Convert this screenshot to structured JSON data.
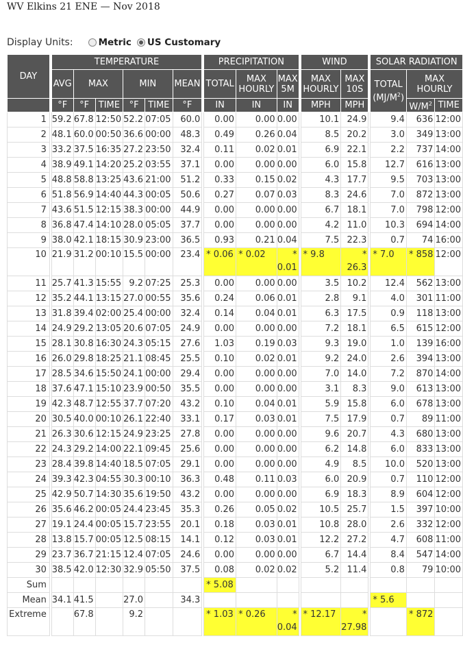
{
  "title": "WV Elkins 21 ENE — Nov 2018",
  "display_units": {
    "label": "Display Units:",
    "options": [
      {
        "label": "Metric",
        "selected": false
      },
      {
        "label": "US Customary",
        "selected": true
      }
    ]
  },
  "headers": {
    "day": "DAY",
    "temperature": "TEMPERATURE",
    "precipitation": "PRECIPITATION",
    "wind": "WIND",
    "solar": "SOLAR RADIATION",
    "avg": "AVG",
    "max": "MAX",
    "min": "MIN",
    "mean": "MEAN",
    "total": "TOTAL",
    "max_hourly": [
      "MAX",
      "HOURLY"
    ],
    "max_5m": [
      "MAX",
      "5M"
    ],
    "wind_max_hourly": [
      "MAX",
      "HOURLY"
    ],
    "max_10s": [
      "MAX",
      "10S"
    ],
    "solar_total": "TOTAL",
    "solar_unit": [
      "(MJ/M",
      "2",
      ")"
    ],
    "solar_max_hourly": [
      "MAX",
      "HOURLY"
    ],
    "units": [
      "°F",
      "°F",
      "TIME",
      "°F",
      "TIME",
      "°F",
      "IN",
      "IN",
      "IN",
      "MPH",
      "MPH",
      "W/M",
      "TIME"
    ]
  },
  "rows": [
    [
      "1",
      "59.2",
      "67.8",
      "12:50",
      "52.2",
      "07:05",
      "60.0",
      "0.00",
      "0.00",
      "0.00",
      "10.1",
      "24.9",
      "9.4",
      "636",
      "12:00"
    ],
    [
      "2",
      "48.1",
      "60.0",
      "00:50",
      "36.6",
      "00:00",
      "48.3",
      "0.49",
      "0.26",
      "0.04",
      "8.5",
      "20.2",
      "3.0",
      "349",
      "13:00"
    ],
    [
      "3",
      "33.2",
      "37.5",
      "16:35",
      "27.2",
      "23:50",
      "32.4",
      "0.11",
      "0.02",
      "0.01",
      "6.9",
      "22.1",
      "2.2",
      "737",
      "14:00"
    ],
    [
      "4",
      "38.9",
      "49.1",
      "14:20",
      "25.2",
      "03:55",
      "37.1",
      "0.00",
      "0.00",
      "0.00",
      "6.0",
      "15.8",
      "12.7",
      "616",
      "13:00"
    ],
    [
      "5",
      "48.8",
      "58.8",
      "13:25",
      "43.6",
      "21:00",
      "51.2",
      "0.33",
      "0.15",
      "0.02",
      "4.3",
      "17.7",
      "9.5",
      "703",
      "13:00"
    ],
    [
      "6",
      "51.8",
      "56.9",
      "14:40",
      "44.3",
      "00:05",
      "50.6",
      "0.27",
      "0.07",
      "0.03",
      "8.3",
      "24.6",
      "7.0",
      "872",
      "13:00"
    ],
    [
      "7",
      "43.6",
      "51.5",
      "12:15",
      "38.3",
      "00:00",
      "44.9",
      "0.00",
      "0.00",
      "0.00",
      "6.7",
      "18.1",
      "7.0",
      "798",
      "12:00"
    ],
    [
      "8",
      "36.8",
      "47.4",
      "14:10",
      "28.0",
      "05:05",
      "37.7",
      "0.00",
      "0.00",
      "0.00",
      "4.2",
      "11.0",
      "10.3",
      "694",
      "14:00"
    ],
    [
      "9",
      "38.0",
      "42.1",
      "18:15",
      "30.9",
      "23:00",
      "36.5",
      "0.93",
      "0.21",
      "0.04",
      "7.5",
      "22.3",
      "0.7",
      "74",
      "16:00"
    ],
    [
      "10",
      "21.9",
      "31.2",
      "00:10",
      "15.5",
      "00:00",
      "23.4",
      "* 0.06",
      "* 0.02",
      "0.01",
      "* 9.8",
      "26.3",
      "* 7.0",
      "* 858",
      "12:00"
    ],
    [
      "11",
      "25.7",
      "41.3",
      "15:55",
      "9.2",
      "07:25",
      "25.3",
      "0.00",
      "0.00",
      "0.00",
      "3.5",
      "10.2",
      "12.4",
      "562",
      "13:00"
    ],
    [
      "12",
      "35.2",
      "44.1",
      "13:15",
      "27.0",
      "00:55",
      "35.6",
      "0.24",
      "0.06",
      "0.01",
      "2.8",
      "9.1",
      "4.0",
      "301",
      "11:00"
    ],
    [
      "13",
      "31.8",
      "39.4",
      "02:00",
      "25.4",
      "00:00",
      "32.4",
      "0.14",
      "0.04",
      "0.01",
      "6.3",
      "17.5",
      "0.9",
      "118",
      "13:00"
    ],
    [
      "14",
      "24.9",
      "29.2",
      "13:05",
      "20.6",
      "07:05",
      "24.9",
      "0.00",
      "0.00",
      "0.00",
      "7.2",
      "18.1",
      "6.5",
      "615",
      "12:00"
    ],
    [
      "15",
      "28.1",
      "30.8",
      "16:30",
      "24.3",
      "05:15",
      "27.6",
      "1.03",
      "0.19",
      "0.03",
      "9.3",
      "19.0",
      "1.0",
      "139",
      "16:00"
    ],
    [
      "16",
      "26.0",
      "29.8",
      "18:25",
      "21.1",
      "08:45",
      "25.5",
      "0.10",
      "0.02",
      "0.01",
      "9.2",
      "24.0",
      "2.6",
      "394",
      "13:00"
    ],
    [
      "17",
      "28.5",
      "34.6",
      "15:50",
      "24.1",
      "00:00",
      "29.4",
      "0.00",
      "0.00",
      "0.00",
      "7.0",
      "14.0",
      "7.2",
      "870",
      "14:00"
    ],
    [
      "18",
      "37.6",
      "47.1",
      "15:10",
      "23.9",
      "00:50",
      "35.5",
      "0.00",
      "0.00",
      "0.00",
      "3.1",
      "8.3",
      "9.0",
      "613",
      "13:00"
    ],
    [
      "19",
      "42.3",
      "48.7",
      "12:55",
      "37.7",
      "07:20",
      "43.2",
      "0.10",
      "0.04",
      "0.01",
      "5.9",
      "15.8",
      "6.0",
      "678",
      "13:00"
    ],
    [
      "20",
      "30.5",
      "40.0",
      "00:10",
      "26.1",
      "22:40",
      "33.1",
      "0.17",
      "0.03",
      "0.01",
      "7.5",
      "17.9",
      "0.7",
      "89",
      "11:00"
    ],
    [
      "21",
      "26.3",
      "30.6",
      "12:15",
      "24.9",
      "23:25",
      "27.8",
      "0.00",
      "0.00",
      "0.00",
      "9.6",
      "20.7",
      "4.3",
      "680",
      "13:00"
    ],
    [
      "22",
      "24.3",
      "29.2",
      "14:00",
      "22.1",
      "09:45",
      "25.6",
      "0.00",
      "0.00",
      "0.00",
      "6.2",
      "14.8",
      "6.0",
      "833",
      "13:00"
    ],
    [
      "23",
      "28.4",
      "39.8",
      "14:40",
      "18.5",
      "07:05",
      "29.1",
      "0.00",
      "0.00",
      "0.00",
      "4.9",
      "8.5",
      "10.0",
      "520",
      "13:00"
    ],
    [
      "24",
      "39.3",
      "42.3",
      "04:55",
      "30.3",
      "00:10",
      "36.3",
      "0.48",
      "0.11",
      "0.03",
      "6.0",
      "20.9",
      "0.7",
      "110",
      "12:00"
    ],
    [
      "25",
      "42.9",
      "50.7",
      "14:30",
      "35.6",
      "19:50",
      "43.2",
      "0.00",
      "0.00",
      "0.00",
      "6.9",
      "18.3",
      "8.9",
      "604",
      "12:00"
    ],
    [
      "26",
      "35.6",
      "46.2",
      "00:05",
      "24.4",
      "23:45",
      "35.3",
      "0.26",
      "0.05",
      "0.02",
      "10.5",
      "25.7",
      "1.5",
      "397",
      "10:00"
    ],
    [
      "27",
      "19.1",
      "24.4",
      "00:05",
      "15.7",
      "23:55",
      "20.1",
      "0.18",
      "0.03",
      "0.01",
      "10.8",
      "28.0",
      "2.6",
      "332",
      "12:00"
    ],
    [
      "28",
      "13.8",
      "15.7",
      "00:05",
      "12.5",
      "08:15",
      "14.1",
      "0.12",
      "0.03",
      "0.01",
      "12.2",
      "27.2",
      "4.7",
      "608",
      "11:00"
    ],
    [
      "29",
      "23.7",
      "36.7",
      "21:15",
      "12.4",
      "07:05",
      "24.6",
      "0.00",
      "0.00",
      "0.00",
      "6.7",
      "14.4",
      "8.4",
      "547",
      "14:00"
    ],
    [
      "30",
      "38.5",
      "42.0",
      "12:30",
      "32.9",
      "05:50",
      "37.5",
      "0.08",
      "0.02",
      "0.02",
      "5.2",
      "11.4",
      "0.8",
      "79",
      "10:00"
    ]
  ],
  "summary": {
    "sum": {
      "label": "Sum",
      "precip_total": "* 5.08"
    },
    "mean": {
      "label": "Mean",
      "avg": "34.1",
      "max": "41.5",
      "min": "27.0",
      "mean": "34.3",
      "solar_total": "* 5.6"
    },
    "extreme": {
      "label": "Extreme",
      "max": "67.8",
      "min": "9.2",
      "precip_total": "* 1.03",
      "precip_max_hourly": "* 0.26",
      "precip_max_5m": "0.04",
      "wind_max_hourly": "* 12.17",
      "wind_max_10s": "27.98",
      "solar_max_hourly": "* 872"
    }
  },
  "asterisk": "*",
  "colors": {
    "header_bg": "#555555",
    "highlight": "#ffff33",
    "border": "#dddddd"
  }
}
